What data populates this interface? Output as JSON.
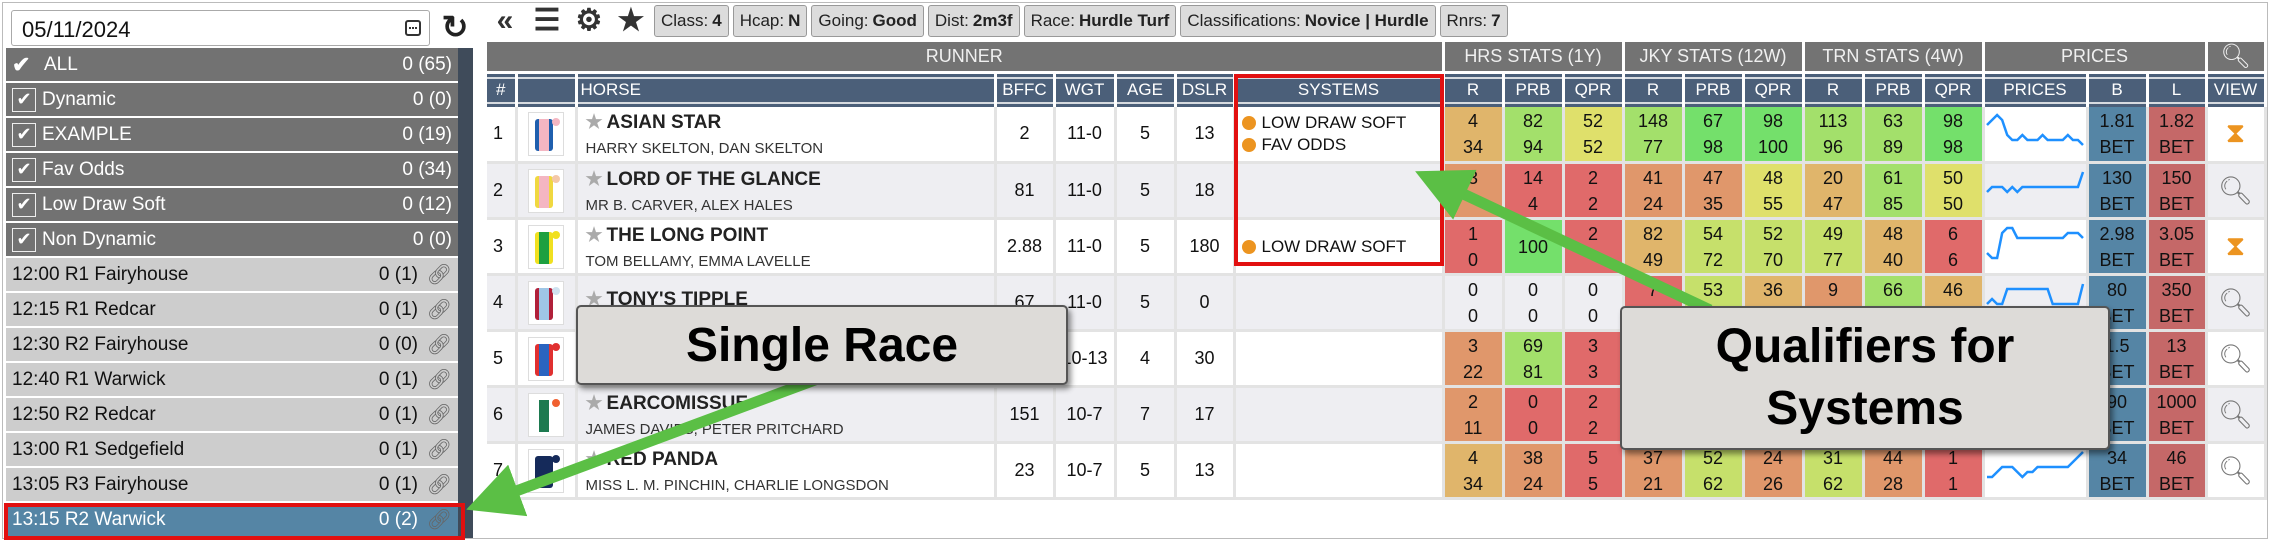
{
  "sidebar": {
    "date": "05/11/2024",
    "filters": [
      {
        "label": "ALL",
        "count": "0 (65)",
        "type": "all"
      },
      {
        "label": "Dynamic",
        "count": "0 (0)",
        "checked": true
      },
      {
        "label": "EXAMPLE",
        "count": "0 (19)",
        "checked": true
      },
      {
        "label": "Fav Odds",
        "count": "0 (34)",
        "checked": true
      },
      {
        "label": "Low Draw Soft",
        "count": "0 (12)",
        "checked": true
      },
      {
        "label": "Non Dynamic",
        "count": "0 (0)",
        "checked": true
      }
    ],
    "races": [
      {
        "label": "12:00 R1 Fairyhouse",
        "count": "0 (1)"
      },
      {
        "label": "12:15 R1 Redcar",
        "count": "0 (1)"
      },
      {
        "label": "12:30 R2 Fairyhouse",
        "count": "0 (0)"
      },
      {
        "label": "12:40 R1 Warwick",
        "count": "0 (1)"
      },
      {
        "label": "12:50 R2 Redcar",
        "count": "0 (1)"
      },
      {
        "label": "13:00 R1 Sedgefield",
        "count": "0 (1)"
      },
      {
        "label": "13:05 R3 Fairyhouse",
        "count": "0 (1)"
      },
      {
        "label": "13:15 R2 Warwick",
        "count": "0 (2)",
        "selected": true
      }
    ]
  },
  "toolbar": {
    "icons": [
      "collapse-icon",
      "menu-icon",
      "gear-icon",
      "star-icon"
    ],
    "chips": [
      {
        "key": "Class:",
        "value": "4"
      },
      {
        "key": "Hcap:",
        "value": "N"
      },
      {
        "key": "Going:",
        "value": "Good"
      },
      {
        "key": "Dist:",
        "value": "2m3f"
      },
      {
        "key": "Race:",
        "value": "Hurdle Turf"
      },
      {
        "key": "Classifications:",
        "value": "Novice | Hurdle"
      },
      {
        "key": "Rnrs:",
        "value": "7"
      }
    ]
  },
  "table": {
    "groups": {
      "runner": "RUNNER",
      "hrs": "HRS STATS (1Y)",
      "jky": "JKY STATS (12W)",
      "trn": "TRN STATS (4W)",
      "prices": "PRICES"
    },
    "columns": [
      "#",
      "",
      "HORSE",
      "BFFC",
      "WGT",
      "AGE",
      "DSLR",
      "SYSTEMS",
      "R",
      "PRB",
      "QPR",
      "R",
      "PRB",
      "QPR",
      "R",
      "PRB",
      "QPR",
      "PRICES",
      "B",
      "L",
      "VIEW"
    ],
    "bet_label": "BET",
    "heat_colors": {
      "red": "#e06a6a",
      "orange": "#e0976b",
      "amber": "#e0b56b",
      "yellow": "#dfe06b",
      "lime": "#c6e06b",
      "lightgreen": "#a3e06b",
      "green": "#74e06b",
      "none": ""
    },
    "rows": [
      {
        "num": "1",
        "horse": "ASIAN STAR",
        "connections": "HARRY SKELTON, DAN SKELTON",
        "bffc": "2",
        "wgt": "11-0",
        "age": "5",
        "dslr": "13",
        "silk": {
          "body": "#f4b6c2",
          "trim": "#1f5fae",
          "cap": "#f4b6c2"
        },
        "systems": [
          "LOW DRAW SOFT",
          "FAV ODDS"
        ],
        "stats": [
          [
            "4",
            "34",
            "amber"
          ],
          [
            "82",
            "94",
            "lightgreen"
          ],
          [
            "52",
            "52",
            "yellow"
          ],
          [
            "148",
            "77",
            "lightgreen"
          ],
          [
            "67",
            "98",
            "green"
          ],
          [
            "98",
            "100",
            "green"
          ],
          [
            "113",
            "96",
            "lightgreen"
          ],
          [
            "63",
            "89",
            "lightgreen"
          ],
          [
            "98",
            "98",
            "green"
          ]
        ],
        "price_trend": [
          5,
          6,
          7,
          6,
          3,
          2,
          2,
          3,
          2,
          2,
          2,
          3,
          2,
          2,
          2,
          2,
          3,
          2,
          2,
          1
        ],
        "back": "1.81",
        "lay": "1.82",
        "view": "hourglass-icon"
      },
      {
        "num": "2",
        "horse": "LORD OF THE GLANCE",
        "connections": "MR B. CARVER, ALEX HALES",
        "bffc": "81",
        "wgt": "11-0",
        "age": "5",
        "dslr": "18",
        "silk": {
          "body": "#f4b6c2",
          "trim": "#f0d840",
          "cap": "#f4c8a8"
        },
        "systems": [],
        "stats": [
          [
            "3",
            "",
            "orange"
          ],
          [
            "14",
            "4",
            "red"
          ],
          [
            "2",
            "2",
            "red"
          ],
          [
            "41",
            "24",
            "orange"
          ],
          [
            "47",
            "35",
            "orange"
          ],
          [
            "48",
            "55",
            "yellow"
          ],
          [
            "20",
            "47",
            "amber"
          ],
          [
            "61",
            "85",
            "lightgreen"
          ],
          [
            "50",
            "50",
            "yellow"
          ]
        ],
        "price_trend": [
          3,
          4,
          4,
          4,
          3,
          4,
          3,
          4,
          4,
          4,
          4,
          4,
          4,
          4,
          4,
          4,
          4,
          4,
          4,
          7
        ],
        "back": "130",
        "lay": "150",
        "view": "search-icon"
      },
      {
        "num": "3",
        "horse": "THE LONG POINT",
        "connections": "TOM BELLAMY, EMMA LAVELLE",
        "bffc": "2.88",
        "wgt": "11-0",
        "age": "5",
        "dslr": "180",
        "silk": {
          "body": "#1ea040",
          "trim": "#f0e020",
          "cap": "#f0e020"
        },
        "systems": [
          "LOW DRAW SOFT"
        ],
        "stats": [
          [
            "1",
            "0",
            "red"
          ],
          [
            "",
            "100",
            "green"
          ],
          [
            "2",
            "",
            "red"
          ],
          [
            "82",
            "49",
            "amber"
          ],
          [
            "54",
            "72",
            "lime"
          ],
          [
            "52",
            "70",
            "lime"
          ],
          [
            "49",
            "77",
            "lime"
          ],
          [
            "48",
            "40",
            "amber"
          ],
          [
            "6",
            "6",
            "red"
          ]
        ],
        "price_trend": [
          2,
          1,
          1,
          6,
          7,
          7,
          5,
          5,
          5,
          5,
          5,
          5,
          5,
          5,
          5,
          5,
          6,
          6,
          6,
          5
        ],
        "back": "2.98",
        "lay": "3.05",
        "view": "hourglass-icon"
      },
      {
        "num": "4",
        "horse": "TONY'S TIPPLE",
        "connections": "",
        "bffc": "67",
        "wgt": "11-0",
        "age": "5",
        "dslr": "0",
        "silk": {
          "body": "#9fc6e6",
          "trim": "#b0203a",
          "cap": "#cfe2f0"
        },
        "systems": [],
        "stats": [
          [
            "0",
            "0",
            "none"
          ],
          [
            "0",
            "0",
            "none"
          ],
          [
            "0",
            "0",
            "none"
          ],
          [
            "7",
            "",
            "red"
          ],
          [
            "53",
            "",
            "lime"
          ],
          [
            "36",
            "",
            "amber"
          ],
          [
            "9",
            "",
            "orange"
          ],
          [
            "66",
            "",
            "lightgreen"
          ],
          [
            "46",
            "",
            "amber"
          ]
        ],
        "price_trend": [
          3,
          4,
          3,
          3,
          6,
          6,
          6,
          6,
          6,
          6,
          6,
          6,
          6,
          3,
          3,
          3,
          3,
          3,
          3,
          7
        ],
        "back": "80",
        "lay": "350",
        "view": "search-icon"
      },
      {
        "num": "5",
        "horse": "",
        "connections": "",
        "bffc": "",
        "wgt": "10-13",
        "age": "4",
        "dslr": "30",
        "silk": {
          "body": "#2a64c0",
          "trim": "#e03030",
          "cap": "#e03030"
        },
        "systems": [],
        "stats": [
          [
            "3",
            "22",
            "orange"
          ],
          [
            "69",
            "81",
            "lightgreen"
          ],
          [
            "3",
            "3",
            "red"
          ],
          [
            "",
            "",
            "none"
          ],
          [
            "",
            "",
            "none"
          ],
          [
            "",
            "",
            "none"
          ],
          [
            "",
            "",
            "none"
          ],
          [
            "",
            "",
            "none"
          ],
          [
            "",
            "",
            "none"
          ]
        ],
        "price_trend": [],
        "back": "1.5",
        "lay": "13",
        "view": "search-icon"
      },
      {
        "num": "6",
        "horse": "EARCOMISSUE",
        "connections": "JAMES DAVIES, PETER PRITCHARD",
        "bffc": "151",
        "wgt": "10-7",
        "age": "7",
        "dslr": "17",
        "silk": {
          "body": "#1d7a50",
          "trim": "#ffffff",
          "cap": "#f06030"
        },
        "systems": [],
        "stats": [
          [
            "2",
            "11",
            "orange"
          ],
          [
            "0",
            "0",
            "red"
          ],
          [
            "2",
            "2",
            "red"
          ],
          [
            "",
            "",
            "none"
          ],
          [
            "",
            "",
            "none"
          ],
          [
            "",
            "",
            "none"
          ],
          [
            "",
            "",
            "none"
          ],
          [
            "",
            "",
            "none"
          ],
          [
            "",
            "",
            "none"
          ]
        ],
        "price_trend": [],
        "back": "90",
        "lay": "1000",
        "view": "search-icon"
      },
      {
        "num": "7",
        "horse": "RED PANDA",
        "connections": "MISS L. M. PINCHIN, CHARLIE LONGSDON",
        "bffc": "23",
        "wgt": "10-7",
        "age": "5",
        "dslr": "13",
        "silk": {
          "body": "#152a5a",
          "trim": "#152a5a",
          "cap": "#152a5a"
        },
        "systems": [],
        "stats": [
          [
            "4",
            "34",
            "amber"
          ],
          [
            "38",
            "24",
            "orange"
          ],
          [
            "5",
            "5",
            "red"
          ],
          [
            "37",
            "21",
            "orange"
          ],
          [
            "52",
            "62",
            "lime"
          ],
          [
            "24",
            "26",
            "orange"
          ],
          [
            "31",
            "62",
            "lime"
          ],
          [
            "44",
            "28",
            "orange"
          ],
          [
            "1",
            "1",
            "red"
          ]
        ],
        "price_trend": [
          2,
          2,
          3,
          4,
          4,
          4,
          3,
          2,
          3,
          3,
          4,
          4,
          4,
          4,
          4,
          4,
          4,
          5,
          6,
          7
        ],
        "back": "34",
        "lay": "46",
        "view": "search-icon"
      }
    ]
  },
  "annotations": {
    "single_race": "Single Race",
    "qualifiers": "Qualifiers for Systems"
  },
  "colors": {
    "accent_red": "#e21010",
    "arrow_green": "#5bbf45",
    "selected_race": "#5585a5",
    "back": "#5585a5",
    "lay": "#c56868",
    "sparkline": "#1e90ff"
  }
}
